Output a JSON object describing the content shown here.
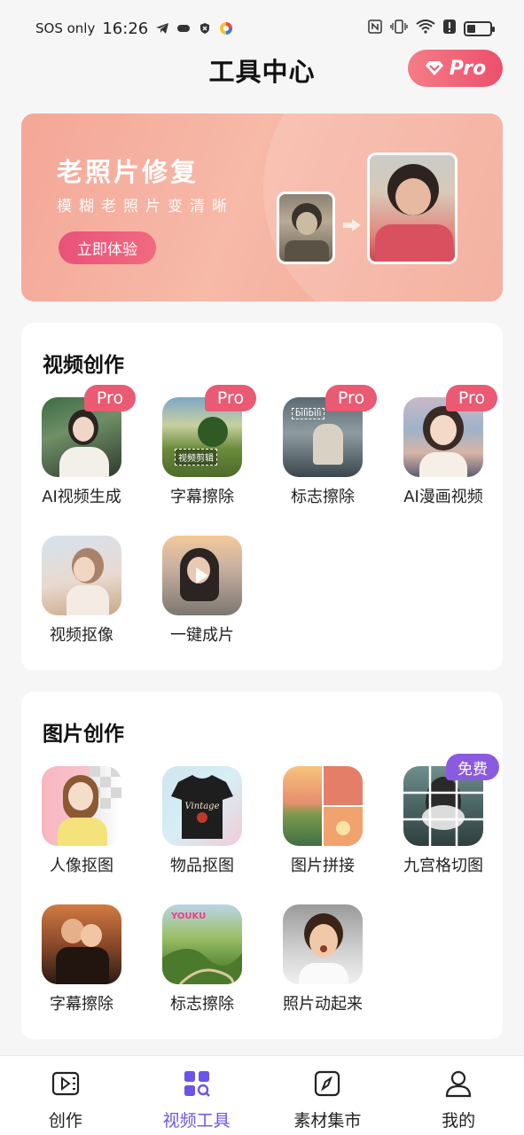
{
  "status_bar": {
    "carrier": "SOS only",
    "time": "16:26",
    "battery_level": 0.3
  },
  "header": {
    "title": "工具中心",
    "pro_label": "Pro"
  },
  "banner": {
    "title": "老照片修复",
    "subtitle": "模糊老照片变清晰",
    "button_label": "立即体验"
  },
  "video_section": {
    "title": "视频创作",
    "tools": [
      {
        "label": "AI视频生成",
        "badge": "Pro"
      },
      {
        "label": "字幕擦除",
        "badge": "Pro",
        "overlay": "视频剪辑"
      },
      {
        "label": "标志擦除",
        "badge": "Pro",
        "overlay": "bilibili"
      },
      {
        "label": "AI漫画视频",
        "badge": "Pro"
      },
      {
        "label": "视频抠像"
      },
      {
        "label": "一键成片"
      }
    ]
  },
  "image_section": {
    "title": "图片创作",
    "tools": [
      {
        "label": "人像抠图"
      },
      {
        "label": "物品抠图",
        "overlay": "Vintage"
      },
      {
        "label": "图片拼接"
      },
      {
        "label": "九宫格切图",
        "badge": "免费"
      },
      {
        "label": "字幕擦除"
      },
      {
        "label": "标志擦除",
        "overlay": "YOUKU"
      },
      {
        "label": "照片动起来"
      }
    ]
  },
  "tab_bar": {
    "tabs": [
      {
        "label": "创作",
        "icon": "video-edit-icon"
      },
      {
        "label": "视频工具",
        "icon": "grid-tools-icon",
        "active": true
      },
      {
        "label": "素材集市",
        "icon": "compass-icon"
      },
      {
        "label": "我的",
        "icon": "person-icon"
      }
    ],
    "active_color": "#6b55e6"
  },
  "colors": {
    "pro_badge": "#ea5a72",
    "free_badge": "#8a5be0",
    "banner": "#f4a797"
  }
}
